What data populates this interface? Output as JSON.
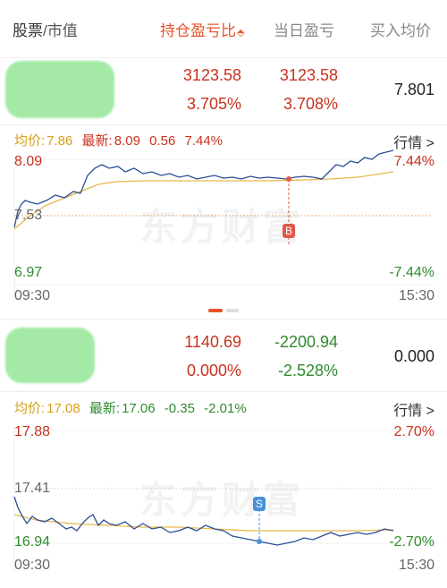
{
  "header": {
    "col_name": "股票",
    "col_name_sep": "/",
    "col_name_sub": "市值",
    "col_pnl": "持仓盈亏比",
    "col_pnl_sort": "⬘",
    "col_day": "当日盈亏",
    "col_buy": "买入均价"
  },
  "holdings": [
    {
      "hold_pnl": "3123.58",
      "hold_pnl_pct": "3.705%",
      "day_pnl": "3123.58",
      "day_pnl_pct": "3.708%",
      "avg_price": "7.801",
      "chart": {
        "avg_label": "均价:",
        "avg_value": "7.86",
        "last_label": "最新:",
        "last_value": "8.09",
        "change": "0.56",
        "change_pct": "7.44%",
        "more": "行情 >",
        "y_top": "8.09",
        "y_mid": "7.53",
        "y_bottom": "6.97",
        "pct_top": "7.44%",
        "pct_bottom": "-7.44%",
        "time_start": "09:30",
        "time_end": "15:30",
        "marker": "B",
        "watermark": "东方财富"
      }
    },
    {
      "hold_pnl": "1140.69",
      "hold_pnl_pct": "0.000%",
      "day_pnl": "-2200.94",
      "day_pnl_pct": "-2.528%",
      "avg_price": "0.000",
      "chart": {
        "avg_label": "均价:",
        "avg_value": "17.08",
        "last_label": "最新:",
        "last_value": "17.06",
        "change": "-0.35",
        "change_pct": "-2.01%",
        "more": "行情 >",
        "y_top": "17.88",
        "y_mid": "17.41",
        "y_bottom": "16.94",
        "pct_top": "2.70%",
        "pct_bottom": "-2.70%",
        "time_start": "09:30",
        "time_end": "15:30",
        "marker": "S",
        "watermark": "东方财富"
      }
    }
  ],
  "colors": {
    "up": "#c8321f",
    "down": "#2e8b2e",
    "accent": "#e8542b",
    "price_line": "#2a4e96",
    "avg_line": "#e8b94a",
    "buy_marker": "#e0584a",
    "sell_marker": "#4a90d9"
  }
}
